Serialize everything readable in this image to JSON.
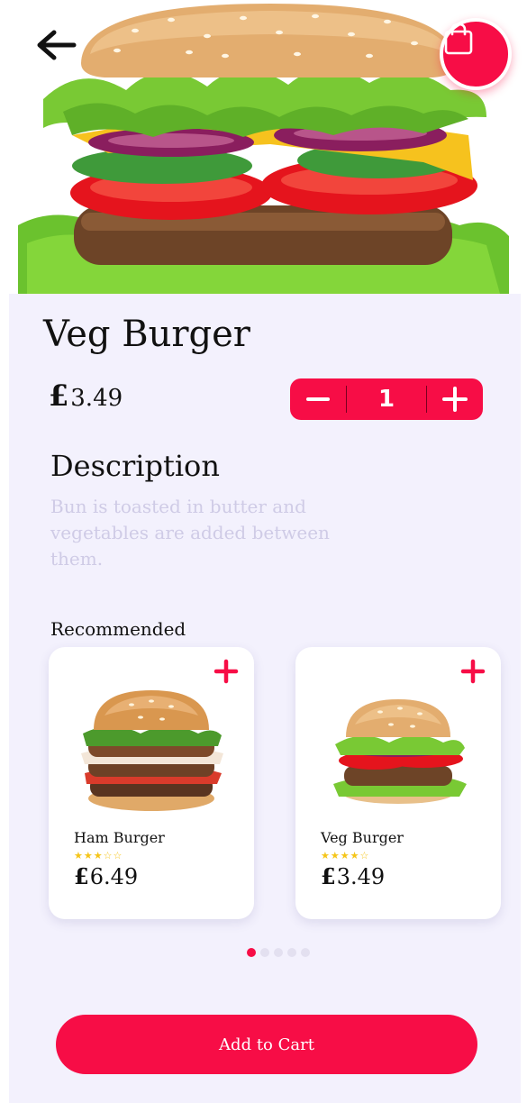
{
  "product": {
    "title": "Veg Burger",
    "currency": "£",
    "price": "3.49",
    "quantity": "1"
  },
  "description": {
    "title": "Description",
    "text": "Bun is toasted in butter and vegetables are added between them."
  },
  "recommended": {
    "title": "Recommended",
    "items": [
      {
        "name": "Ham Burger",
        "currency": "£",
        "price": "6.49",
        "rating": 3
      },
      {
        "name": "Veg Burger",
        "currency": "£",
        "price": "3.49",
        "rating": 4
      }
    ],
    "page_count": 5,
    "active_page": 0
  },
  "cart_button": {
    "label": "Add to Cart"
  },
  "icons": {
    "back": "arrow-left-icon",
    "bag": "shopping-bag-icon",
    "minus": "minus-icon",
    "plus": "plus-icon",
    "star": "star-icon"
  },
  "colors": {
    "accent": "#f70d46",
    "panel": "#f3f1fd",
    "star": "#f5c518",
    "muted_text": "#cfcbe6"
  }
}
